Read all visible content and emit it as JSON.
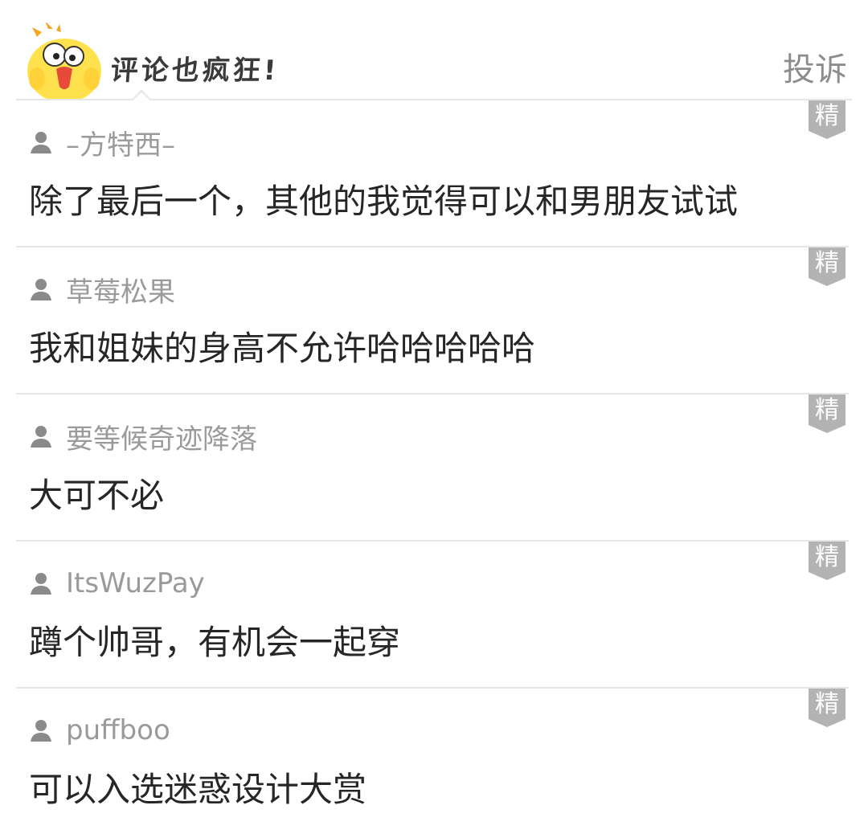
{
  "header": {
    "title": "评论也疯狂!",
    "report_label": "投诉",
    "mascot_icon": "yellow-chick-mascot-icon"
  },
  "badge_label": "精",
  "colors": {
    "username": "#9a9a9a",
    "comment_text": "#262626",
    "divider": "#e6e6e6",
    "badge_bg": "#b3b3b3",
    "report": "#8c8c8c"
  },
  "comments": [
    {
      "username": "–方特西–",
      "text": "除了最后一个，其他的我觉得可以和男朋友试试"
    },
    {
      "username": "草莓松果",
      "text": "我和姐妹的身高不允许哈哈哈哈哈"
    },
    {
      "username": "要等候奇迹降落",
      "text": "大可不必"
    },
    {
      "username": "ItsWuzPay",
      "text": "蹲个帅哥，有机会一起穿"
    },
    {
      "username": "puffboo",
      "text": "可以入选迷惑设计大赏"
    }
  ]
}
